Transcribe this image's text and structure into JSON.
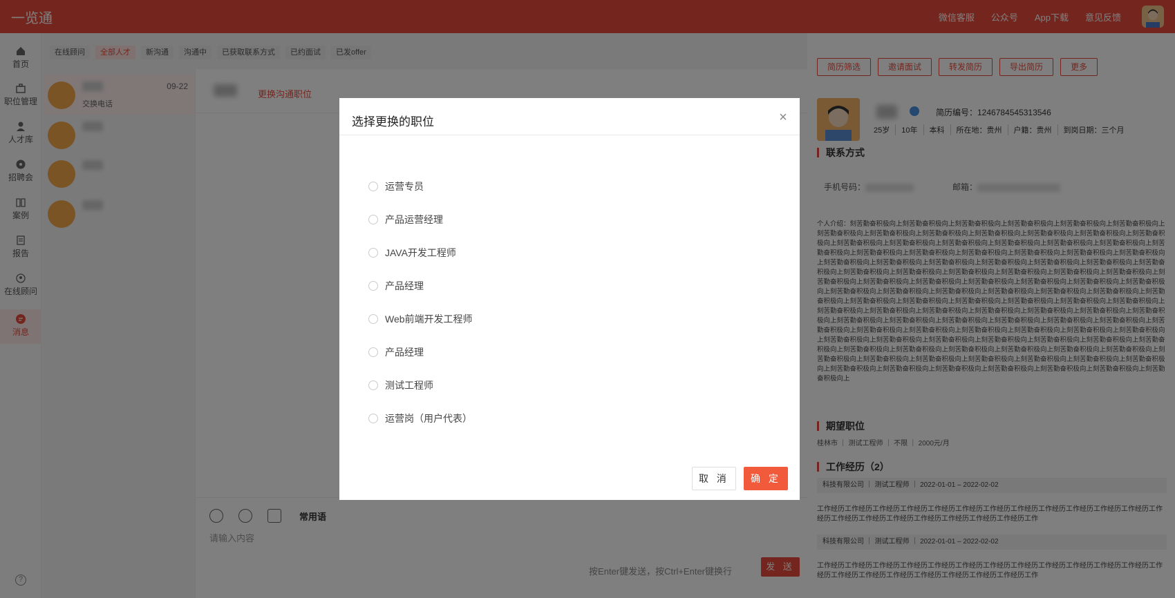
{
  "app": {
    "brand": "一览通"
  },
  "header": {
    "links": [
      "微信客服",
      "公众号",
      "App下载",
      "意见反馈"
    ]
  },
  "nav": [
    {
      "label": "首页",
      "icon": "home-icon"
    },
    {
      "label": "职位管理",
      "icon": "briefcase-icon"
    },
    {
      "label": "人才库",
      "icon": "user-icon"
    },
    {
      "label": "招聘会",
      "icon": "fair-icon"
    },
    {
      "label": "案例",
      "icon": "book-icon"
    },
    {
      "label": "报告",
      "icon": "report-icon"
    },
    {
      "label": "在线顾问",
      "icon": "advisor-icon"
    },
    {
      "label": "消息",
      "icon": "message-icon",
      "active": true
    }
  ],
  "filters": [
    "在线顾问",
    "全部人才",
    "新沟通",
    "沟通中",
    "已获取联系方式",
    "已约面试",
    "已发offer"
  ],
  "conversations": [
    {
      "date": "09-22",
      "sub": "交换电话"
    }
  ],
  "chat": {
    "change_position": "更换沟通职位",
    "common_phrases": "常用语",
    "input_placeholder": "请输入内容",
    "hint": "按Enter键发送，按Ctrl+Enter键换行",
    "send": "发 送"
  },
  "profile": {
    "actions": [
      "简历筛选",
      "邀请面试",
      "转发简历",
      "导出简历",
      "更多"
    ],
    "resume_no": "简历编号：1246784545313546",
    "meta": [
      "25岁",
      "10年",
      "本科",
      "所在地：贵州",
      "户籍：贵州",
      "到岗日期：三个月"
    ],
    "contact_title": "联系方式",
    "phone_label": "手机号码：",
    "email_label": "邮箱：",
    "intro": "个人介绍：刻苦勤奋积极向上刻苦勤奋积极向上刻苦勤奋积极向上刻苦勤奋积极向上刻苦勤奋积极向上刻苦勤奋积极向上刻苦勤奋积极向上刻苦勤奋积极向上刻苦勤奋积极向上刻苦勤奋积极向上刻苦勤奋积极向上刻苦勤奋积极向上刻苦勤奋积极向上刻苦勤奋积极向上刻苦勤奋积极向上刻苦勤奋积极向上刻苦勤奋积极向上刻苦勤奋积极向上刻苦勤奋积极向上刻苦勤奋积极向上刻苦勤奋积极向上刻苦勤奋积极向上刻苦勤奋积极向上刻苦勤奋积极向上刻苦勤奋积极向上刻苦勤奋积极向上刻苦勤奋积极向上刻苦勤奋积极向上刻苦勤奋积极向上刻苦勤奋积极向上刻苦勤奋积极向上刻苦勤奋积极向上刻苦勤奋积极向上刻苦勤奋积极向上刻苦勤奋积极向上刻苦勤奋积极向上刻苦勤奋积极向上刻苦勤奋积极向上刻苦勤奋积极向上刻苦勤奋积极向上刻苦勤奋积极向上刻苦勤奋积极向上刻苦勤奋积极向上刻苦勤奋积极向上刻苦勤奋积极向上刻苦勤奋积极向上刻苦勤奋积极向上刻苦勤奋积极向上刻苦勤奋积极向上刻苦勤奋积极向上刻苦勤奋积极向上刻苦勤奋积极向上刻苦勤奋积极向上刻苦勤奋积极向上刻苦勤奋积极向上刻苦勤奋积极向上刻苦勤奋积极向上刻苦勤奋积极向上刻苦勤奋积极向上刻苦勤奋积极向上刻苦勤奋积极向上刻苦勤奋积极向上刻苦勤奋积极向上刻苦勤奋积极向上刻苦勤奋积极向上刻苦勤奋积极向上刻苦勤奋积极向上刻苦勤奋积极向上刻苦勤奋积极向上刻苦勤奋积极向上刻苦勤奋积极向上刻苦勤奋积极向上刻苦勤奋积极向上刻苦勤奋积极向上刻苦勤奋积极向上刻苦勤奋积极向上刻苦勤奋积极向上刻苦勤奋积极向上刻苦勤奋积极向上刻苦勤奋积极向上刻苦勤奋积极向上刻苦勤奋积极向上刻苦勤奋积极向上刻苦勤奋积极向上刻苦勤奋积极向上刻苦勤奋积极向上刻苦勤奋积极向上刻苦勤奋积极向上刻苦勤奋积极向上刻苦勤奋积极向上刻苦勤奋积极向上刻苦勤奋积极向上刻苦勤奋积极向上刻苦勤奋积极向上刻苦勤奋积极向上刻苦勤奋积极向上刻苦勤奋积极向上刻苦勤奋积极向上刻苦勤奋积极向上刻苦勤奋积极向上刻苦勤奋积极向上刻苦勤奋积极向上刻苦勤奋积极向上刻苦勤奋积极向上刻苦勤奋积极向上刻苦勤奋积极向上",
    "expect_title": "期望职位",
    "expect": "桂林市 ｜ 测试工程师 ｜ 不限 ｜ 2000元/月",
    "work_title": "工作经历（2）",
    "work": [
      {
        "row": "科技有限公司 ｜ 测试工程师 ｜ 2022-01-01 – 2022-02-02",
        "desc": "工作经历工作经历工作经历工作经历工作经历工作经历工作经历工作经历工作经历工作经历工作经历工作经历工作经历工作经历工作经历工作经历工作经历工作经历工作经历工作经历工作"
      },
      {
        "row": "科技有限公司 ｜ 测试工程师 ｜ 2022-01-01 – 2022-02-02",
        "desc": "工作经历工作经历工作经历工作经历工作经历工作经历工作经历工作经历工作经历工作经历工作经历工作经历工作经历工作经历工作经历工作经历工作经历工作经历工作经历工作经历工作"
      }
    ]
  },
  "modal": {
    "title": "选择更换的职位",
    "options": [
      "运营专员",
      "产品运营经理",
      "JAVA开发工程师",
      "产品经理",
      "Web前端开发工程师",
      "产品经理",
      "测试工程师",
      "运营岗（用户代表）"
    ],
    "cancel": "取 消",
    "confirm": "确 定"
  }
}
